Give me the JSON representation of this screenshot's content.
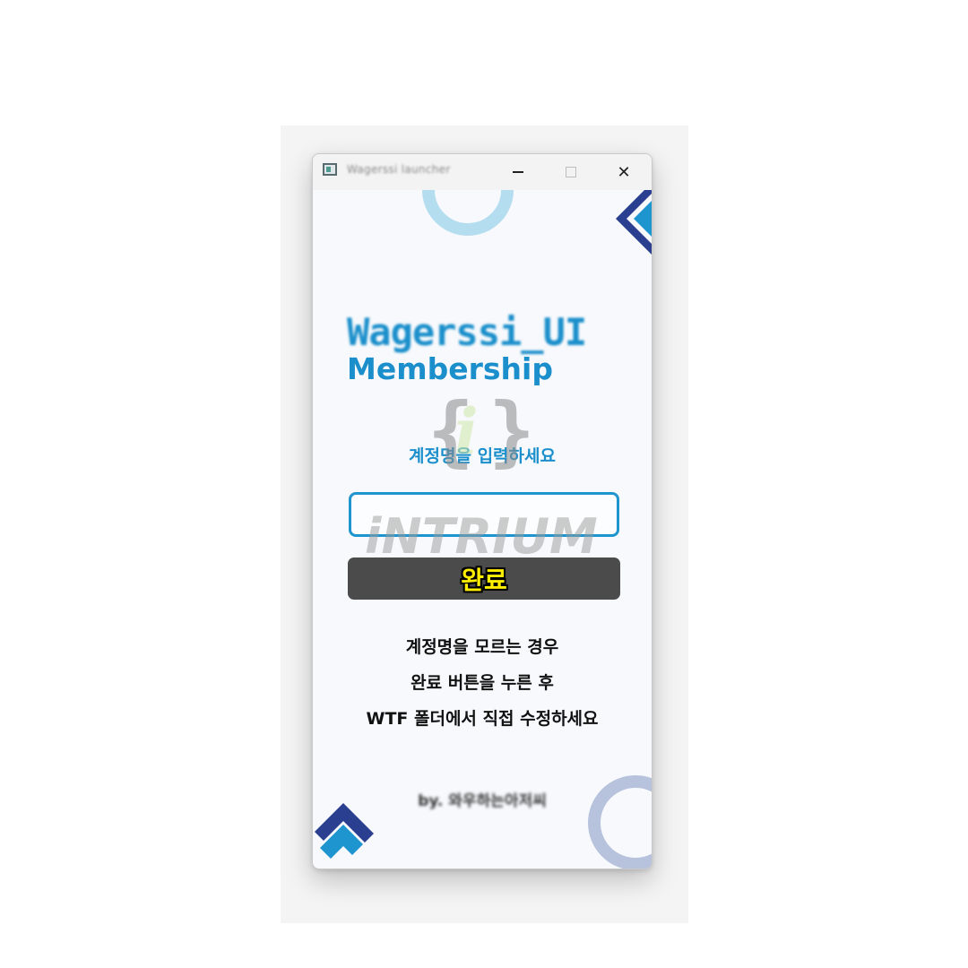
{
  "window": {
    "title": "Wagerssi launcher",
    "minimize_icon": "minimize-icon",
    "maximize_icon": "maximize-icon",
    "close_icon": "close-icon",
    "close_glyph": "✕"
  },
  "logo": {
    "line1": "Wagerssi_UI",
    "line2": "Membership"
  },
  "form": {
    "prompt": "계정명을 입력하세요",
    "input_value": "",
    "submit_label": "완료"
  },
  "notes": {
    "line1": "계정명을 모르는 경우",
    "line2": "완료 버튼을 누른 후",
    "line3": "WTF 폴더에서 직접 수정하세요"
  },
  "credit": "by. 와우하는아저씨",
  "watermark": {
    "brand_i": "i",
    "brand": "iNTRIUM"
  },
  "colors": {
    "accent": "#1b8fcb",
    "button_bg": "#4b4b4b",
    "button_text": "#ffee00",
    "deco_light_blue": "#b5ddf0",
    "deco_navy": "#2a3f8f",
    "deco_blue": "#1e95cf",
    "deco_ring_lavender": "#b7c3dd"
  }
}
